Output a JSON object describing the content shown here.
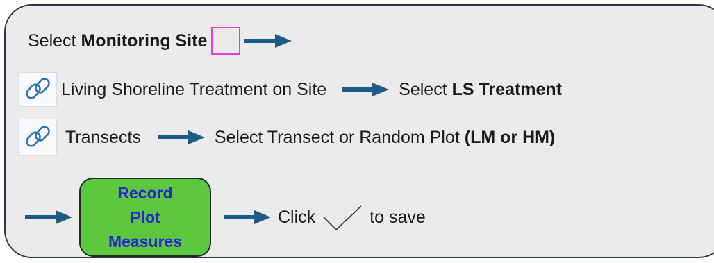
{
  "row1": {
    "prefix": "Select",
    "bold": "Monitoring Site"
  },
  "row2": {
    "link_text": "Living Shoreline Treatment on Site",
    "select_prefix": "Select",
    "select_bold": "LS Treatment"
  },
  "row3": {
    "link_text": "Transects",
    "select_text": "Select Transect or Random Plot",
    "select_bold": "(LM or HM)"
  },
  "row4": {
    "button_lines": [
      "Record",
      "Plot",
      "Measures"
    ],
    "click_text": "Click",
    "save_text": "to save"
  },
  "colors": {
    "arrow": "#1e5b86",
    "link_icon": "#2e74b5",
    "button_fill": "#5cc83f",
    "button_text": "#2a25d0",
    "site_box_border": "#e83ad6",
    "panel_fill": "#ebebeb"
  },
  "icons": {
    "link": "link-icon",
    "arrow": "right-arrow-icon",
    "check": "checkmark-icon"
  }
}
